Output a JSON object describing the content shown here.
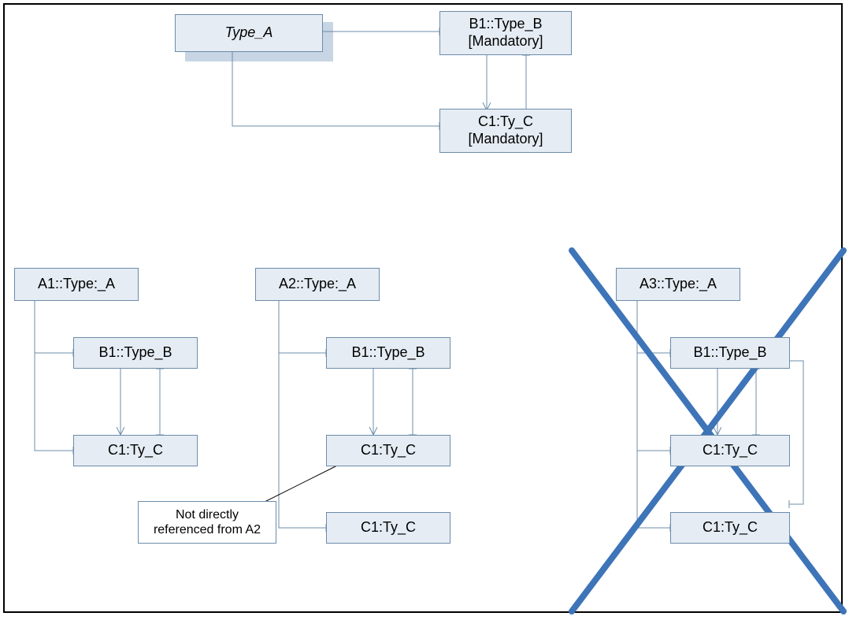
{
  "colors": {
    "node_fill": "#e5ecf3",
    "node_border": "#6c8caa",
    "x_stroke": "#3e74b8"
  },
  "top": {
    "type_a": "Type_A",
    "b1": "B1::Type_B\n[Mandatory]",
    "c1": "C1:Ty_C\n[Mandatory]"
  },
  "sub": {
    "a1": {
      "root": "A1::Type:_A",
      "b1": "B1::Type_B",
      "c1": "C1:Ty_C"
    },
    "a2": {
      "root": "A2::Type:_A",
      "b1": "B1::Type_B",
      "c1_upper": "C1:Ty_C",
      "c1_lower": "C1:Ty_C",
      "note": "Not directly\nreferenced from A2"
    },
    "a3": {
      "root": "A3::Type:_A",
      "b1": "B1::Type_B",
      "c1_upper": "C1:Ty_C",
      "c1_lower": "C1:Ty_C"
    }
  }
}
